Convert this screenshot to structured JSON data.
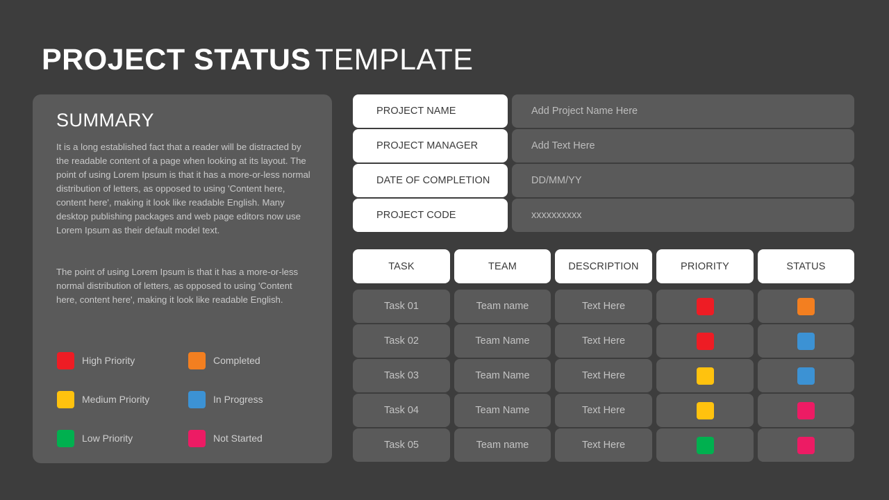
{
  "header": {
    "title_bold": "PROJECT STATUS",
    "title_light": "TEMPLATE"
  },
  "summary": {
    "heading": "SUMMARY",
    "paragraphs": [
      "It is a long established fact that a reader will be distracted by the readable content of a page when looking at its layout.  The point of using Lorem Ipsum is that it has a more-or-less normal distribution  of letters, as opposed to using 'Content here, content here', making it look like readable English. Many desktop publishing packages and web page editors now use Lorem Ipsum as their default model text.",
      "The point of using Lorem Ipsum is that it has a more-or-less normal distribution  of letters, as opposed to using 'Content here, content here', making it look like readable English."
    ]
  },
  "legend": {
    "items": [
      {
        "label": "High Priority",
        "color": "#ee1c24",
        "key": "high"
      },
      {
        "label": "Completed",
        "color": "#f37f20",
        "key": "completed"
      },
      {
        "label": "Medium Priority",
        "color": "#ffc20e",
        "key": "medium"
      },
      {
        "label": "In Progress",
        "color": "#3c92d4",
        "key": "in-progress"
      },
      {
        "label": "Low Priority",
        "color": "#00b04f",
        "key": "low"
      },
      {
        "label": "Not Started",
        "color": "#ed1b64",
        "key": "not-started"
      }
    ]
  },
  "project_info": {
    "rows": [
      {
        "label": "PROJECT NAME",
        "value": "Add Project Name Here"
      },
      {
        "label": "PROJECT MANAGER",
        "value": "Add Text Here"
      },
      {
        "label": "DATE OF COMPLETION",
        "value": "DD/MM/YY"
      },
      {
        "label": "PROJECT CODE",
        "value": "xxxxxxxxxx"
      }
    ]
  },
  "task_table": {
    "headers": [
      "TASK",
      "TEAM",
      "DESCRIPTION",
      "PRIORITY",
      "STATUS"
    ],
    "rows": [
      {
        "task": "Task 01",
        "team": "Team name",
        "description": "Text Here",
        "priority": "High Priority",
        "priority_color": "#ee1c24",
        "status": "Completed",
        "status_color": "#f37f20"
      },
      {
        "task": "Task 02",
        "team": "Team Name",
        "description": "Text Here",
        "priority": "High Priority",
        "priority_color": "#ee1c24",
        "status": "In Progress",
        "status_color": "#3c92d4"
      },
      {
        "task": "Task 03",
        "team": "Team Name",
        "description": "Text Here",
        "priority": "Medium Priority",
        "priority_color": "#ffc20e",
        "status": "In Progress",
        "status_color": "#3c92d4"
      },
      {
        "task": "Task 04",
        "team": "Team Name",
        "description": "Text Here",
        "priority": "Medium Priority",
        "priority_color": "#ffc20e",
        "status": "Not Started",
        "status_color": "#ed1b64"
      },
      {
        "task": "Task 05",
        "team": "Team name",
        "description": "Text Here",
        "priority": "Low Priority",
        "priority_color": "#00b04f",
        "status": "Not Started",
        "status_color": "#ed1b64"
      }
    ]
  }
}
